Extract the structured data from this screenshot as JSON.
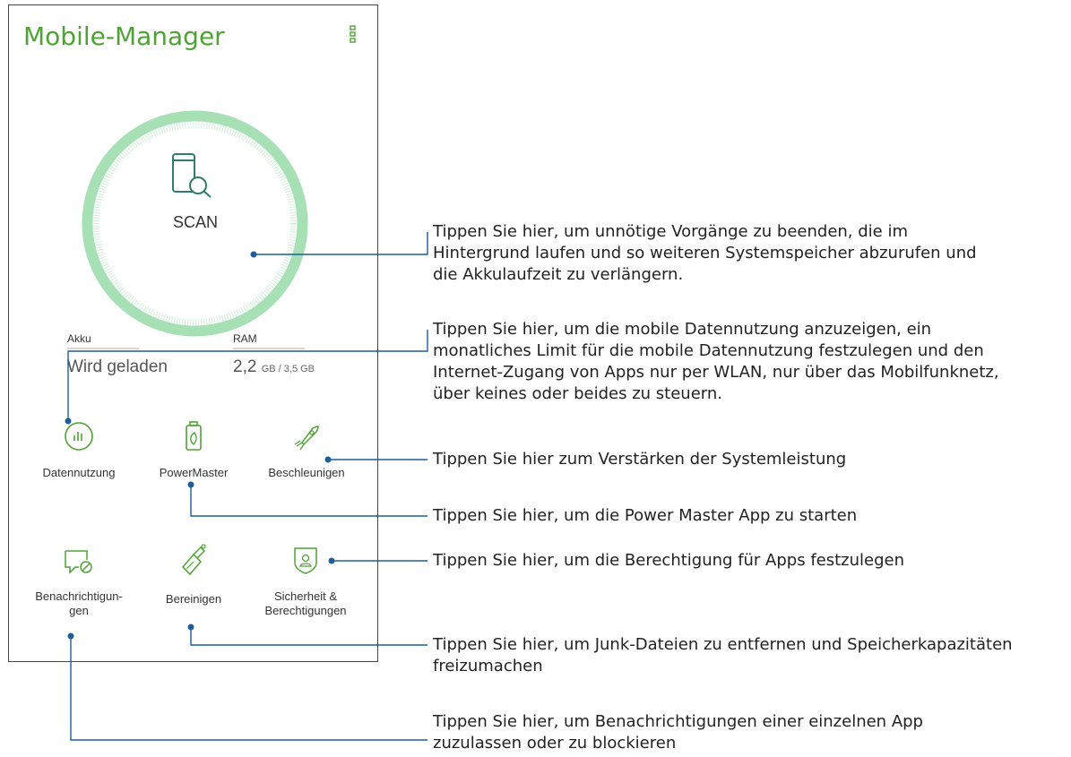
{
  "app": {
    "title": "Mobile-Manager",
    "menu_icon": "more-options-icon"
  },
  "scan": {
    "label": "SCAN",
    "icon": "phone-search-icon"
  },
  "stats": {
    "battery": {
      "label": "Akku",
      "value": "Wird geladen"
    },
    "ram": {
      "label": "RAM",
      "value": "2,2",
      "detail": "GB / 3,5 GB"
    }
  },
  "tiles": [
    {
      "label": "Datennutzung",
      "icon": "data-usage-icon"
    },
    {
      "label": "PowerMaster",
      "icon": "battery-leaf-icon"
    },
    {
      "label": "Beschleunigen",
      "icon": "rocket-icon"
    },
    {
      "label_line1": "Benachrichtigun-",
      "label_line2": "gen",
      "icon": "notification-block-icon"
    },
    {
      "label": "Bereinigen",
      "icon": "broom-icon"
    },
    {
      "label_line1": "Sicherheit &",
      "label_line2": "Berechtigungen",
      "icon": "security-shield-icon"
    }
  ],
  "notes": {
    "scan": [
      "Tippen Sie hier, um unnötige Vorgänge zu beenden, die im",
      "Hintergrund laufen und so weiteren Systemspeicher abzurufen und",
      "die Akkulaufzeit zu verlängern."
    ],
    "data": [
      "Tippen Sie hier, um die mobile Datennutzung anzuzeigen, ein",
      "monatliches Limit für die mobile Datennutzung festzulegen und den",
      "Internet-Zugang von Apps nur per WLAN, nur über das Mobilfunknetz,",
      "über keines oder beides zu steuern."
    ],
    "boost": "Tippen Sie hier zum Verstärken der Systemleistung",
    "power": "Tippen Sie hier, um die Power Master App zu starten",
    "security": "Tippen Sie hier, um die Berechtigung für Apps festzulegen",
    "clean": [
      "Tippen Sie hier, um Junk-Dateien zu entfernen und Speicherkapazitäten",
      "freizumachen"
    ],
    "notify": [
      "Tippen Sie hier, um Benachrichtigungen einer einzelnen App",
      "zuzulassen oder zu blockieren"
    ]
  },
  "colors": {
    "brand_green": "#4ea334",
    "ring_green": "#9fdcae",
    "callout_blue": "#1f5f96"
  }
}
